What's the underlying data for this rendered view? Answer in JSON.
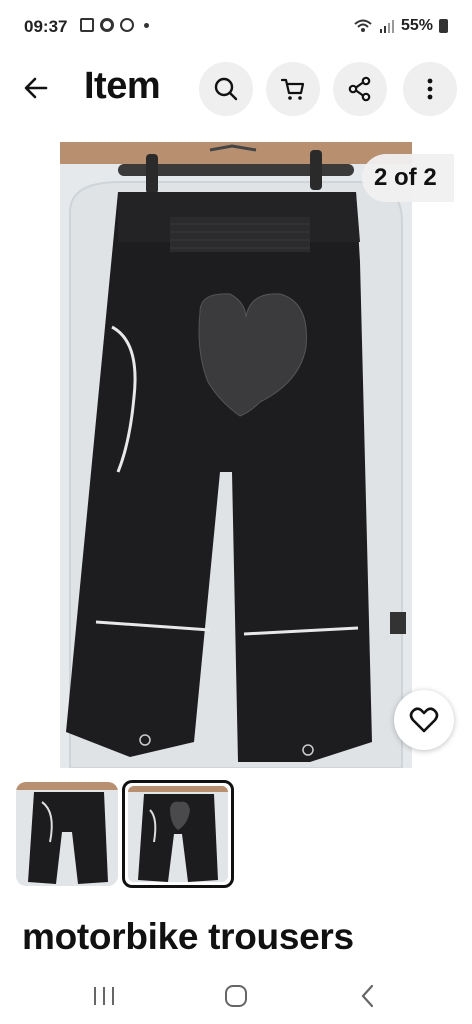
{
  "status": {
    "time": "09:37",
    "battery": "55%",
    "icons": [
      "image-icon",
      "chrome-icon",
      "circle-icon",
      "dot-icon",
      "wifi-icon",
      "signal-icon",
      "battery-icon"
    ]
  },
  "header": {
    "title": "Item",
    "actions": [
      "search-icon",
      "cart-icon",
      "share-icon",
      "more-icon"
    ]
  },
  "gallery": {
    "counter": "2 of 2",
    "current_index": 2,
    "total": 2
  },
  "item": {
    "title": "motorbike trousers"
  },
  "colors": {
    "background": "#ffffff",
    "button_bg": "#efefef",
    "trousers": "#1d1d1f",
    "door": "#e9ecee",
    "selected_border": "#111111"
  },
  "nav": {
    "buttons": [
      "recents-icon",
      "home-icon",
      "back-icon"
    ]
  }
}
